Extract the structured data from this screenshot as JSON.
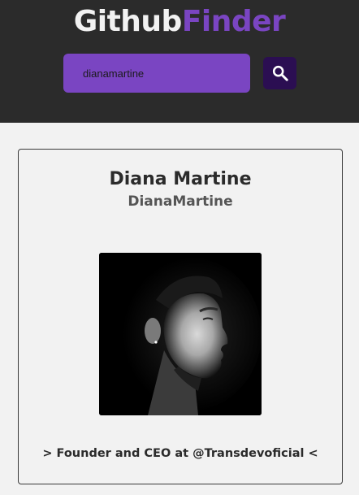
{
  "app": {
    "logo_part1": "Github",
    "logo_part2": "Finder",
    "accent_color": "#7a45c2",
    "header_color": "#2b2b2b"
  },
  "search": {
    "value": "dianamartine",
    "button_icon": "search-icon"
  },
  "profile": {
    "name": "Diana Martine",
    "login": "DianaMartine",
    "avatar": "avatar-portrait",
    "bio": "> Founder and CEO at @Transdevoficial <"
  }
}
